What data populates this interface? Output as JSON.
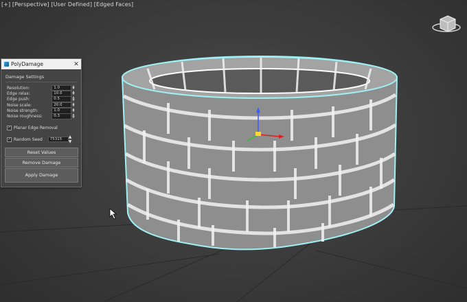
{
  "viewport": {
    "labels": [
      "[+]",
      "[Perspective]",
      "[User Defined]",
      "[Edged Faces]"
    ]
  },
  "dialog": {
    "title": "PolyDamage",
    "section_label": "Damage Settings",
    "params": [
      {
        "label": "Resolution:",
        "value": "1.0"
      },
      {
        "label": "Edge relax:",
        "value": "10.0"
      },
      {
        "label": "Edge push:",
        "value": "0.5"
      },
      {
        "label": "Noise scale:",
        "value": "20.0"
      },
      {
        "label": "Noise strength:",
        "value": "1.0"
      },
      {
        "label": "Noise roughness:",
        "value": "0.3"
      }
    ],
    "planar_edge_label": "Planar Edge Removal",
    "random_seed_label": "Random Seed",
    "random_seed_value": "75315",
    "reset_label": "Reset Values",
    "remove_label": "Remove Damage",
    "apply_label": "Apply Damage"
  },
  "colors": {
    "viewport_bg": "#3b3b3b",
    "selection_outline": "#9ff0f2",
    "brick_fill": "#8e8e8e",
    "mortar_wire": "#ffffff"
  },
  "icons": [
    "window-icon",
    "close-icon",
    "checkbox-checked-icon",
    "spinner-icon",
    "viewcube-icon",
    "gizmo-icon",
    "mouse-cursor-icon"
  ]
}
